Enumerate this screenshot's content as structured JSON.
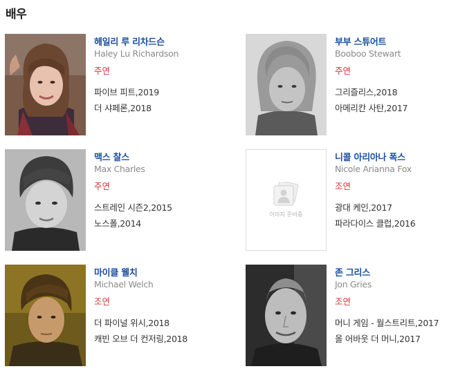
{
  "section": {
    "title": "배우"
  },
  "actors": [
    {
      "name_ko": "헤일리 루 리차드슨",
      "name_en": "Haley Lu Richardson",
      "role": "주연",
      "works": [
        "파이브 피트,2019",
        "더 샤페론,2018"
      ],
      "photo": "portrait-color"
    },
    {
      "name_ko": "부부 스튜어트",
      "name_en": "Booboo Stewart",
      "role": "주연",
      "works": [
        "그리즐리스,2018",
        "아메리칸 사탄,2017"
      ],
      "photo": "portrait-bw"
    },
    {
      "name_ko": "맥스 찰스",
      "name_en": "Max Charles",
      "role": "주연",
      "works": [
        "스트레인 시즌2,2015",
        "노스폴,2014"
      ],
      "photo": "portrait-bw"
    },
    {
      "name_ko": "니콜 아리아나 폭스",
      "name_en": "Nicole Arianna Fox",
      "role": "조연",
      "works": [
        "광대 케인,2017",
        "파라다이스 클럽,2016"
      ],
      "photo": "placeholder",
      "placeholder_text": "이미지 준비중"
    },
    {
      "name_ko": "마이클 웰치",
      "name_en": "Michael Welch",
      "role": "조연",
      "works": [
        "더 파이널 위시,2018",
        "캐빈 오브 더 컨저링,2018"
      ],
      "photo": "portrait-color"
    },
    {
      "name_ko": "존 그리스",
      "name_en": "Jon Gries",
      "role": "조연",
      "works": [
        "머니 게임 - 월스트리트,2017",
        "올 어바웃 더 머니,2017"
      ],
      "photo": "portrait-bw"
    }
  ],
  "colors": {
    "name_link": "#1a4fa0",
    "english_name": "#8a8a8a",
    "role": "#d1363a",
    "work": "#333333"
  }
}
